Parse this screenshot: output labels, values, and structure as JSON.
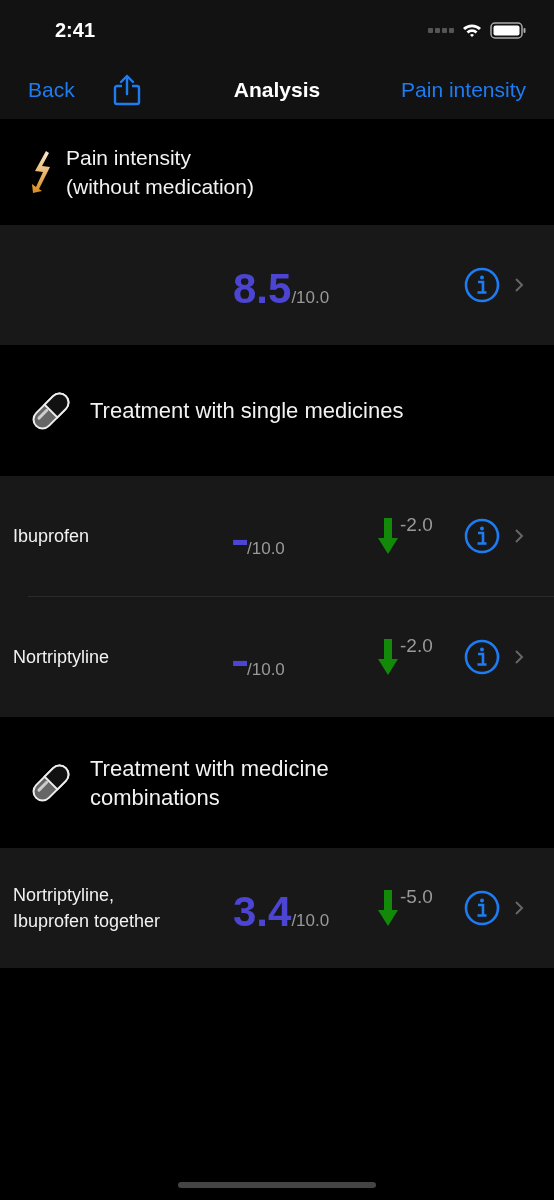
{
  "status_bar": {
    "time": "2:41"
  },
  "nav": {
    "back": "Back",
    "title": "Analysis",
    "right": "Pain intensity"
  },
  "sections": [
    {
      "kind": "baseline",
      "title": "Pain intensity\n(without medication)",
      "rows": [
        {
          "score": "8.5",
          "scale": "/10.0"
        }
      ]
    },
    {
      "kind": "treatment",
      "title": "Treatment with single medicines",
      "rows": [
        {
          "name": "Ibuprofen",
          "score": "-",
          "scale": "/10.0",
          "change": "-2.0"
        },
        {
          "name": "Nortriptyline",
          "score": "-",
          "scale": "/10.0",
          "change": "-2.0"
        }
      ]
    },
    {
      "kind": "treatment",
      "title": "Treatment with medicine\ncombinations",
      "rows": [
        {
          "name": "Nortriptyline,\nIbuprofen together",
          "score": "3.4",
          "scale": "/10.0",
          "change": "-5.0"
        }
      ]
    }
  ]
}
